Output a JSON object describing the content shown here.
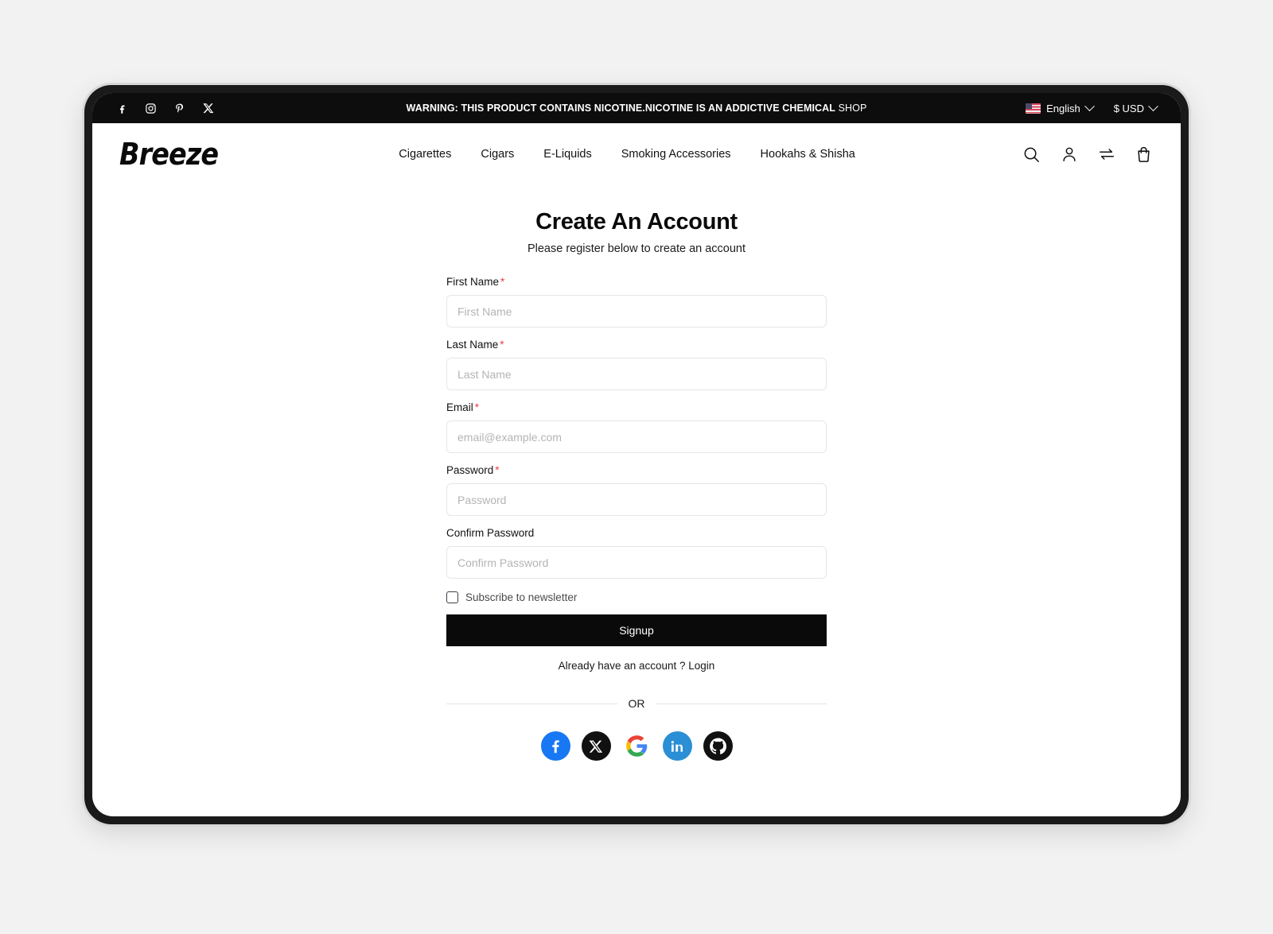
{
  "topbar": {
    "social_icons": [
      {
        "name": "facebook-icon",
        "label": "Facebook"
      },
      {
        "name": "instagram-icon",
        "label": "Instagram"
      },
      {
        "name": "pinterest-icon",
        "label": "Pinterest"
      },
      {
        "name": "x-icon",
        "label": "X"
      }
    ],
    "notice_warning": "WARNING: THIS PRODUCT CONTAINS NICOTINE.NICOTINE IS AN ADDICTIVE CHEMICAL",
    "notice_shop": "SHOP",
    "language": "English",
    "currency": "$ USD"
  },
  "header": {
    "logo": "Breeze",
    "nav": [
      {
        "label": "Cigarettes"
      },
      {
        "label": "Cigars"
      },
      {
        "label": "E-Liquids"
      },
      {
        "label": "Smoking Accessories"
      },
      {
        "label": "Hookahs & Shisha"
      }
    ],
    "icons": [
      {
        "name": "search-icon"
      },
      {
        "name": "account-icon"
      },
      {
        "name": "compare-icon"
      },
      {
        "name": "cart-icon"
      }
    ]
  },
  "main": {
    "title": "Create An Account",
    "subtitle": "Please register below to create an account",
    "fields": [
      {
        "label": "First Name",
        "required": true,
        "placeholder": "First Name",
        "value": "",
        "type": "text"
      },
      {
        "label": "Last Name",
        "required": true,
        "placeholder": "Last Name",
        "value": "",
        "type": "text"
      },
      {
        "label": "Email",
        "required": true,
        "placeholder": "email@example.com",
        "value": "",
        "type": "email"
      },
      {
        "label": "Password",
        "required": true,
        "placeholder": "Password",
        "value": "",
        "type": "password"
      },
      {
        "label": "Confirm Password",
        "required": false,
        "placeholder": "Confirm Password",
        "value": "",
        "type": "password"
      }
    ],
    "newsletter_label": "Subscribe to newsletter",
    "newsletter_checked": false,
    "signup_label": "Signup",
    "login_prompt": "Already have an account ? Login",
    "or_label": "OR",
    "social_logins": [
      {
        "name": "facebook-login-icon",
        "label": "Facebook",
        "color": "#1877f2"
      },
      {
        "name": "x-login-icon",
        "label": "X",
        "color": "#111111"
      },
      {
        "name": "google-login-icon",
        "label": "Google",
        "color": "#4285f4"
      },
      {
        "name": "linkedin-login-icon",
        "label": "LinkedIn",
        "color": "#2a8fd4"
      },
      {
        "name": "github-login-icon",
        "label": "GitHub",
        "color": "#111111"
      }
    ]
  },
  "colors": {
    "page_background": "#f2f2f2",
    "topbar_background": "#0d0d0d",
    "accent_required": "#ef3b42",
    "button_primary": "#0a0a0a"
  }
}
